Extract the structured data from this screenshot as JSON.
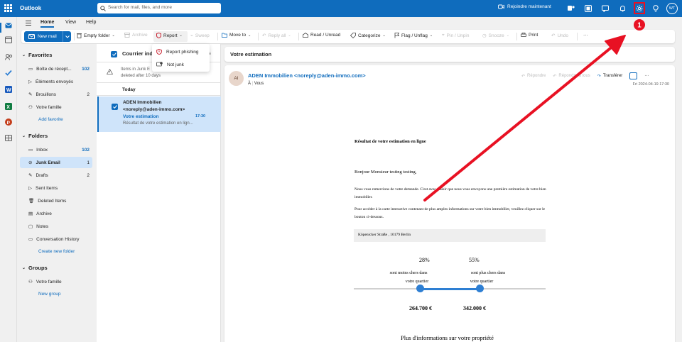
{
  "app": {
    "name": "Outlook"
  },
  "search": {
    "placeholder": "Search for mail, files, and more"
  },
  "topbar": {
    "join_label": "Rejoindre maintenant",
    "avatar_initials": "WT"
  },
  "menu": {
    "tabs": [
      "Home",
      "View",
      "Help"
    ],
    "active": "Home"
  },
  "ribbon": {
    "new_mail": "New mail",
    "empty_folder": "Empty folder",
    "archive": "Archive",
    "report": "Report",
    "sweep": "Sweep",
    "move_to": "Move to",
    "reply_all": "Reply all",
    "read_unread": "Read / Unread",
    "categorize": "Categorize",
    "flag_unflag": "Flag / Unflag",
    "pin_unpin": "Pin / Unpin",
    "snooze": "Snooze",
    "print": "Print",
    "undo": "Undo",
    "more": "···"
  },
  "report_menu": {
    "items": [
      "Report phishing",
      "Not junk"
    ]
  },
  "folders": {
    "favorites_title": "Favorites",
    "favorites": [
      {
        "label": "Boîte de récept...",
        "count": "102"
      },
      {
        "label": "Éléments envoyés",
        "count": ""
      },
      {
        "label": "Brouillons",
        "count": "2"
      },
      {
        "label": "Votre famille",
        "count": ""
      }
    ],
    "add_favorite": "Add favorite",
    "folders_title": "Folders",
    "items": [
      {
        "label": "Inbox",
        "count": "102"
      },
      {
        "label": "Junk Email",
        "count": "1"
      },
      {
        "label": "Drafts",
        "count": "2"
      },
      {
        "label": "Sent Items",
        "count": ""
      },
      {
        "label": "Deleted Items",
        "count": ""
      },
      {
        "label": "Archive",
        "count": ""
      },
      {
        "label": "Notes",
        "count": ""
      },
      {
        "label": "Conversation History",
        "count": ""
      }
    ],
    "create_folder": "Create new folder",
    "groups_title": "Groups",
    "groups": [
      {
        "label": "Votre famille"
      }
    ],
    "new_group": "New group"
  },
  "list": {
    "title": "Courrier ind",
    "notice_line1": "Items in Junk E",
    "notice_line2": "deleted after 10 days",
    "section": "Today",
    "message": {
      "sender": "ADEN Immobilien",
      "address": "<noreply@aden-immo.com>",
      "subject": "Votre estimation",
      "time": "17:30",
      "preview": "Résultat de votre estimation en lign..."
    }
  },
  "reading": {
    "subject": "Votre estimation",
    "avatar": "AI",
    "from": "ADEN Immobilien <noreply@aden-immo.com>",
    "to_prefix": "À",
    "to": "Vous",
    "reply": "Répondre",
    "reply_all": "Répondre à tous",
    "forward": "Transférer",
    "date": "Fri 2024-04-19 17:30"
  },
  "email_body": {
    "heading": "Résultat de votre estimation en ligne",
    "greeting": "Bonjour Monsieur testing testing,",
    "para1": "Nous vous remercions de votre demande. C'est avec plaisir que nous vous envoyons une première estimation de votre bien immobilier.",
    "para2": "Pour accéder à la carte interactive contenant de plus amples informations sur votre bien immobilier, veuillez cliquer sur le bouton ci-dessous.",
    "address": "Köpenicker Straße , 10179 Berlin",
    "low_pct": "28%",
    "high_pct": "55%",
    "low_label_1": "sont moins chers dans",
    "low_label_2": "votre quartier",
    "high_label_1": "sont plus chers dans",
    "high_label_2": "votre quartier",
    "low_price": "264.700 €",
    "high_price": "342.000 €",
    "more_info": "Plus d'informations sur votre propriété"
  },
  "annotation": {
    "number": "1",
    "color": "#e81123"
  }
}
